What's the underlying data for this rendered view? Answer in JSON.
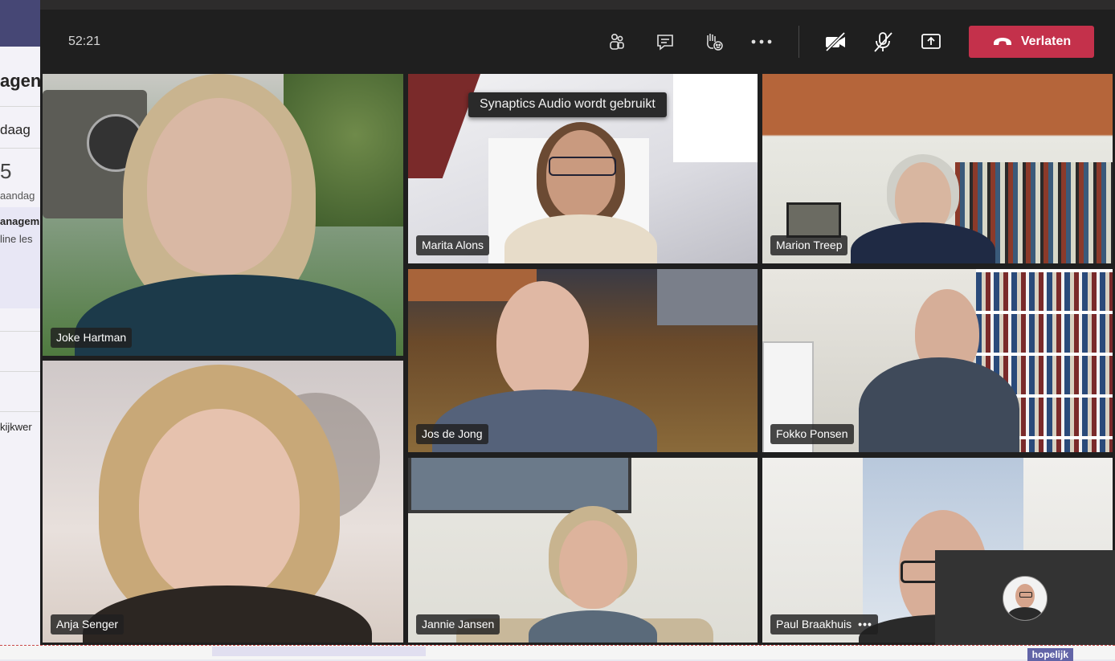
{
  "background_app": {
    "header_fragment": "agend",
    "day_label": "daag",
    "date_number": "5",
    "weekday_fragment": "aandag",
    "event_title_fragment": "anagem",
    "event_subtitle_fragment": "line les",
    "list_item_fragment": "kijkwer",
    "bottom_button_fragment": "hopelijk"
  },
  "meeting": {
    "timer": "52:21",
    "controls": {
      "participants_icon": "participants-icon",
      "chat_icon": "chat-icon",
      "raise_hand_icon": "raise-hand-icon",
      "more_icon": "more-options-icon",
      "camera_icon": "camera-off-icon",
      "mic_icon": "mic-off-icon",
      "share_icon": "share-screen-icon",
      "leave_label": "Verlaten",
      "leave_icon": "hang-up-icon"
    },
    "tooltip": "Synaptics Audio wordt gebruikt",
    "participants": [
      {
        "name": "Joke Hartman"
      },
      {
        "name": "Marita Alons"
      },
      {
        "name": "Marion Treep"
      },
      {
        "name": "Jos de Jong"
      },
      {
        "name": "Fokko Ponsen"
      },
      {
        "name": "Anja Senger"
      },
      {
        "name": "Jannie Jansen"
      },
      {
        "name": "Paul Braakhuis",
        "more": "•••"
      }
    ],
    "accent_colors": {
      "leave": "#c4314b",
      "teams_purple": "#6264a7"
    }
  }
}
